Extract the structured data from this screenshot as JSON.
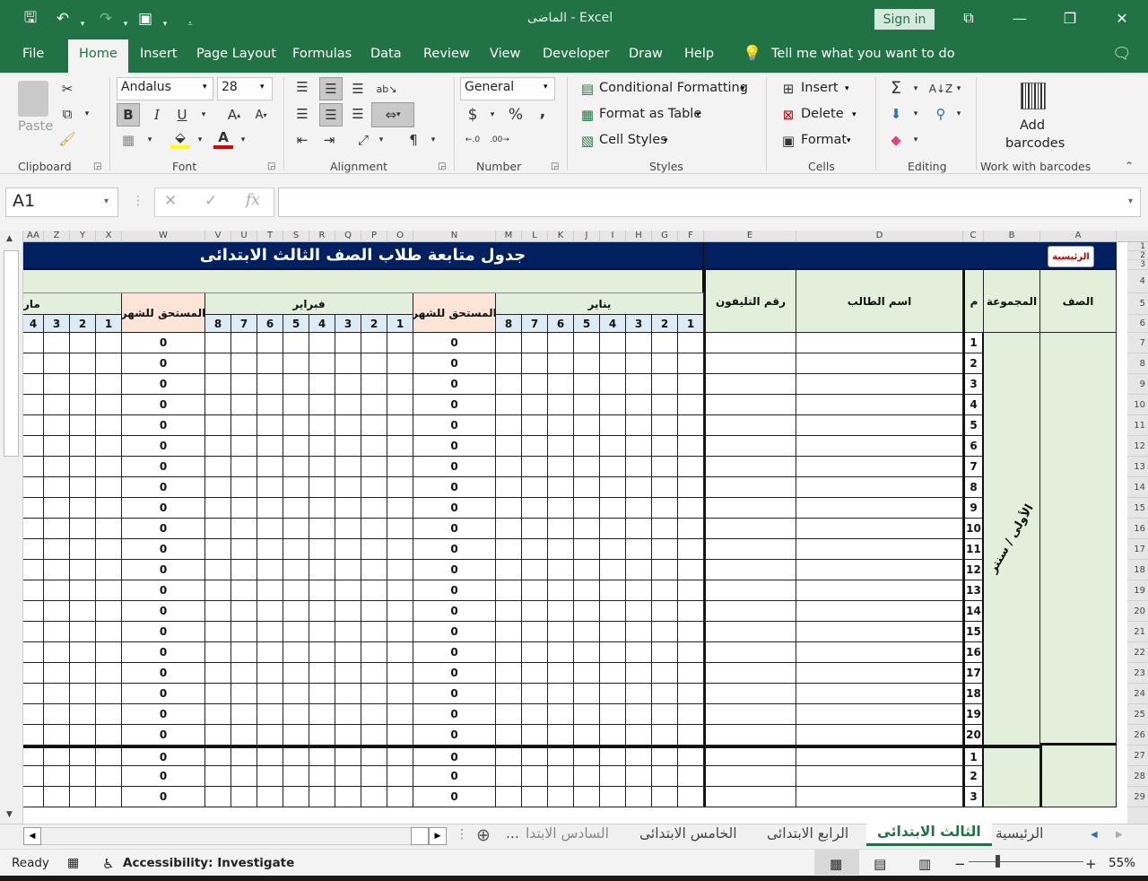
{
  "window": {
    "title": "الماضى  -  Excel",
    "sign_in": "Sign in"
  },
  "tabs": [
    "File",
    "Home",
    "Insert",
    "Page Layout",
    "Formulas",
    "Data",
    "Review",
    "View",
    "Developer",
    "Draw",
    "Help"
  ],
  "tell_me": "Tell me what you want to do",
  "ribbon": {
    "clipboard": {
      "paste": "Paste",
      "label": "Clipboard"
    },
    "font": {
      "name": "Andalus",
      "size": "28",
      "bold": "B",
      "italic": "I",
      "underline": "U",
      "label": "Font"
    },
    "alignment": {
      "label": "Alignment"
    },
    "number": {
      "format": "General",
      "currency": "$",
      "percent": "%",
      "comma": ",",
      "label": "Number"
    },
    "styles": {
      "conditional": "Conditional Formatting",
      "format_table": "Format as Table",
      "cell_styles": "Cell Styles",
      "label": "Styles"
    },
    "cells": {
      "insert": "Insert",
      "delete": "Delete",
      "format": "Format",
      "label": "Cells"
    },
    "editing": {
      "label": "Editing"
    },
    "barcodes": {
      "add": "Add",
      "barcodes": "barcodes",
      "label": "Work with barcodes"
    }
  },
  "formula_bar": {
    "name_box": "A1",
    "formula": "",
    "fx": "fx"
  },
  "columns": [
    "AA",
    "Z",
    "Y",
    "X",
    "W",
    "V",
    "U",
    "T",
    "S",
    "R",
    "Q",
    "P",
    "O",
    "N",
    "M",
    "L",
    "K",
    "J",
    "I",
    "H",
    "G",
    "F",
    "E",
    "D",
    "C",
    "B",
    "A"
  ],
  "rows": [
    "1",
    "2",
    "3",
    "4",
    "5",
    "6",
    "7",
    "8",
    "9",
    "10",
    "11",
    "12",
    "13",
    "14",
    "15",
    "16",
    "17",
    "18",
    "19",
    "20",
    "21",
    "22",
    "23",
    "24",
    "25",
    "26",
    "27",
    "28",
    "29"
  ],
  "sheet": {
    "title": "جدول متابعة طلاب الصف الثالث الابتدائى",
    "home_button": "الرئيسية",
    "headers": {
      "class": "الصف",
      "group": "المجموعة",
      "num": "م",
      "student": "اسم الطالب",
      "phone": "رقم التليفون",
      "jan": "يناير",
      "feb": "فبراير",
      "mar": "مار",
      "due": "المستحق للشهر"
    },
    "weeks": [
      "1",
      "2",
      "3",
      "4",
      "5",
      "6",
      "7",
      "8"
    ],
    "group_value": "الأولى / سنتر",
    "row_numbers": [
      "1",
      "2",
      "3",
      "4",
      "5",
      "6",
      "7",
      "8",
      "9",
      "10",
      "11",
      "12",
      "13",
      "14",
      "15",
      "16",
      "17",
      "18",
      "19",
      "20",
      "1",
      "2",
      "3"
    ],
    "due_value": "0"
  },
  "sheet_tabs": [
    "الرئيسية",
    "الثالث الابتدائى",
    "الرابع الابتدائى",
    "الخامس الابتدائى",
    "السادس الابتدا",
    "..."
  ],
  "status": {
    "ready": "Ready",
    "accessibility": "Accessibility: Investigate",
    "zoom": "55%"
  },
  "colors": {
    "excel_green": "#217346",
    "title_navy": "#002060",
    "light_green": "#e2efda",
    "peach": "#fce4d6",
    "light_blue": "#ddebf7"
  }
}
